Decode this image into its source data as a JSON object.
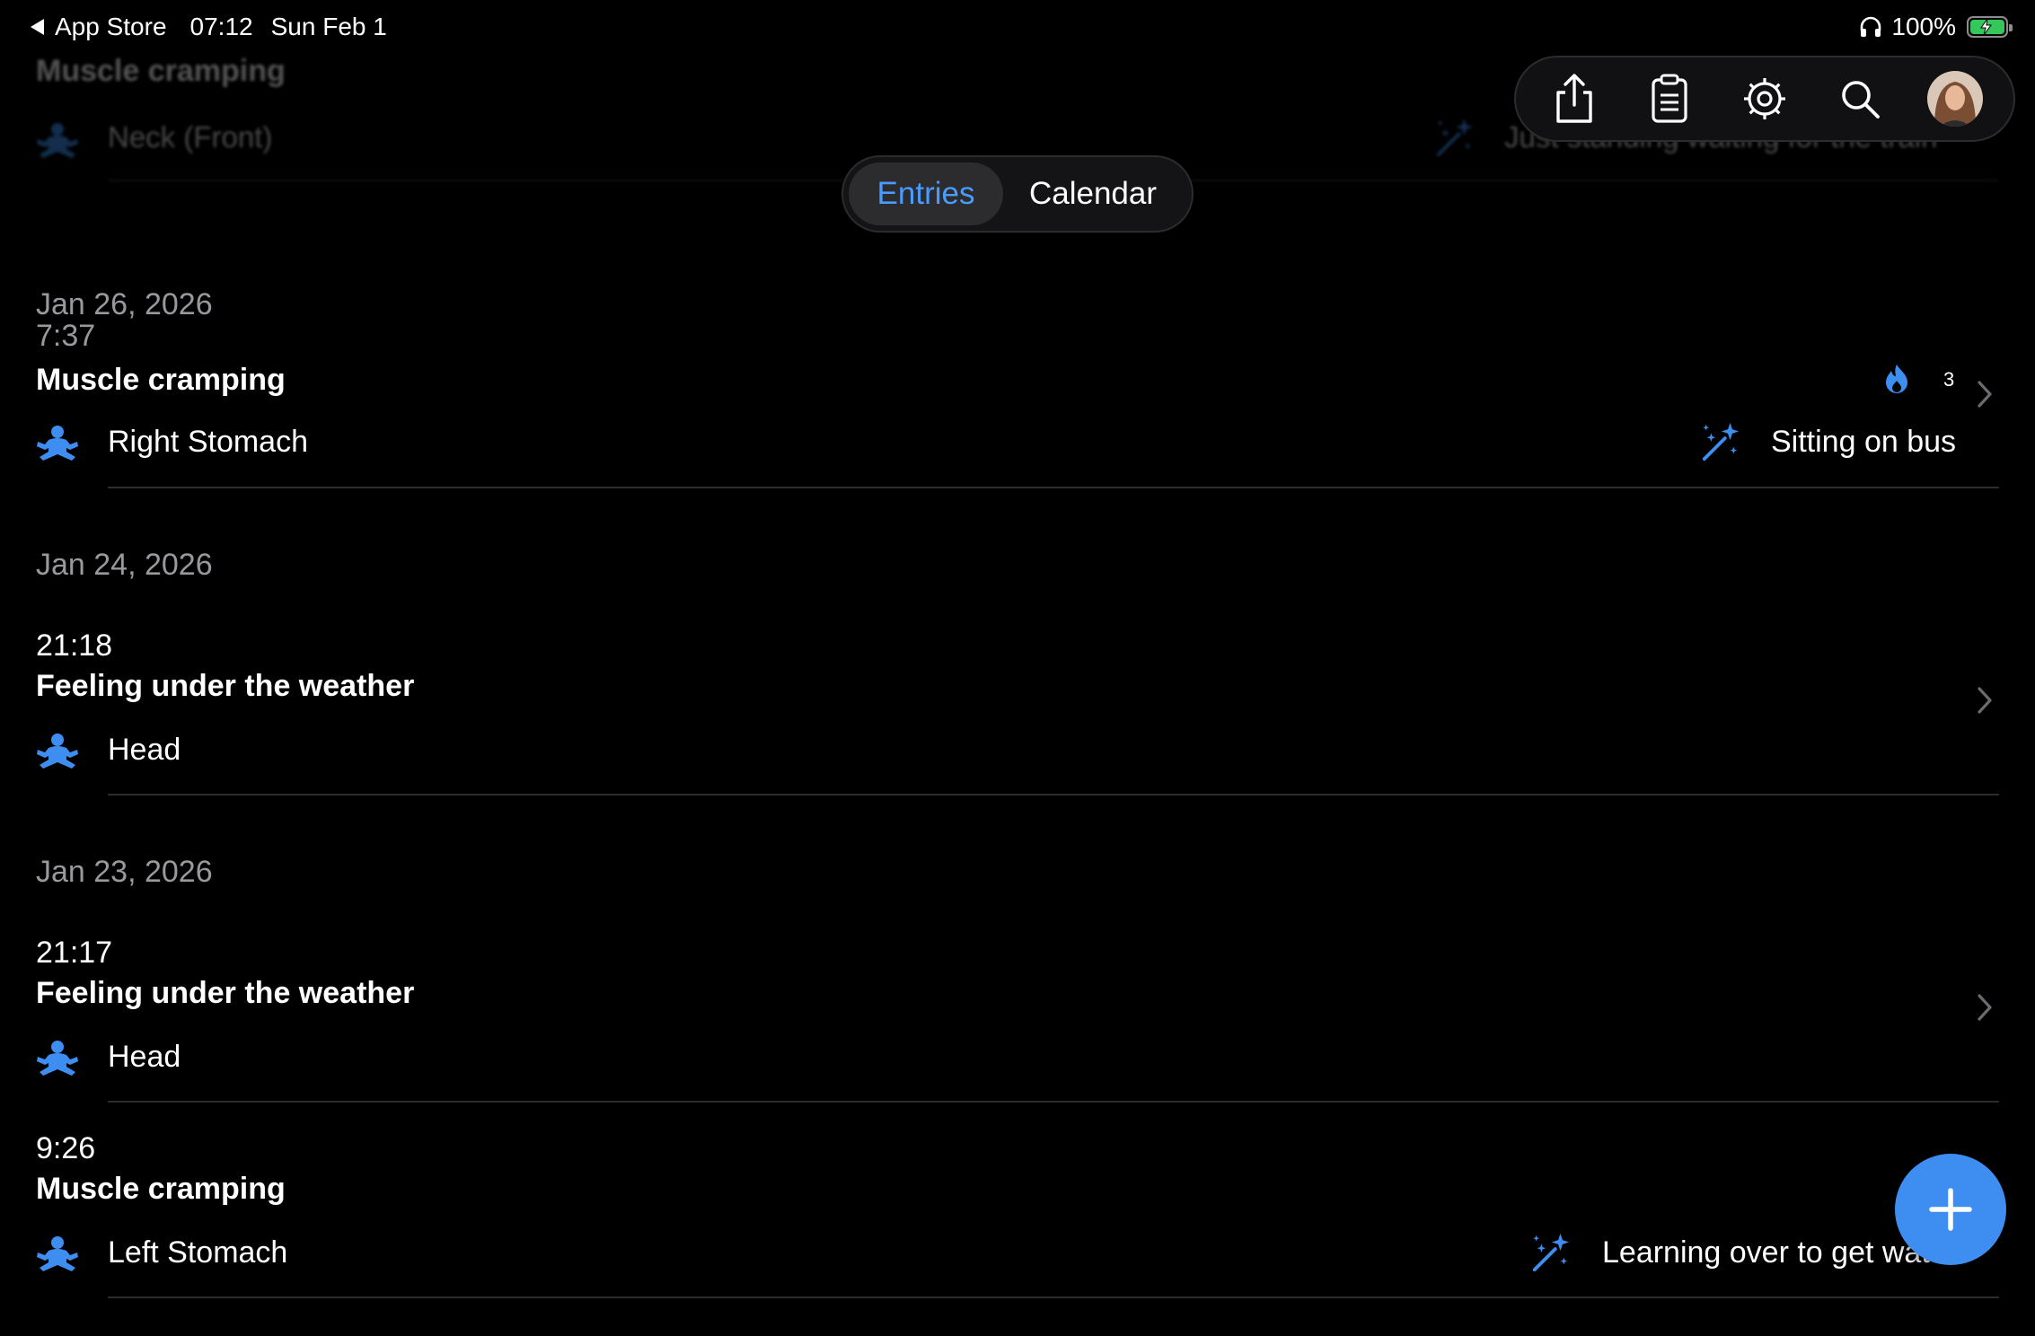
{
  "status_bar": {
    "back_app": "App Store",
    "time": "07:12",
    "date": "Sun Feb 1",
    "battery_percent": "100%",
    "battery_level": 1.0
  },
  "faded_row": {
    "title": "Muscle cramping",
    "location": "Neck (Front)",
    "activity": "Just standing waiting for the train"
  },
  "toolbar": {
    "share": "share-icon",
    "clipboard": "clipboard-icon",
    "settings": "gear-icon",
    "search": "search-icon",
    "avatar": "avatar"
  },
  "segmented": {
    "entries_label": "Entries",
    "calendar_label": "Calendar",
    "selected": "Entries"
  },
  "groups": [
    {
      "date": "Jan 26, 2026",
      "entries": [
        {
          "time": "7:37",
          "title": "Muscle cramping",
          "location": "Right Stomach",
          "activity": "Sitting on bus",
          "intensity_count": "3"
        }
      ]
    },
    {
      "date": "Jan 24, 2026",
      "entries": [
        {
          "time": "21:18",
          "title": "Feeling under the weather",
          "location": "Head"
        }
      ]
    },
    {
      "date": "Jan 23, 2026",
      "entries": [
        {
          "time": "21:17",
          "title": "Feeling under the weather",
          "location": "Head"
        },
        {
          "time": "9:26",
          "title": "Muscle cramping",
          "location": "Left Stomach",
          "activity": "Learning over to get water"
        }
      ]
    }
  ],
  "fab": {
    "icon": "plus-icon"
  },
  "colors": {
    "accent": "#3d8ef0",
    "selected_segment_text": "#4a9bff",
    "date_header": "#98989d",
    "separator": "#2c2c2e"
  }
}
